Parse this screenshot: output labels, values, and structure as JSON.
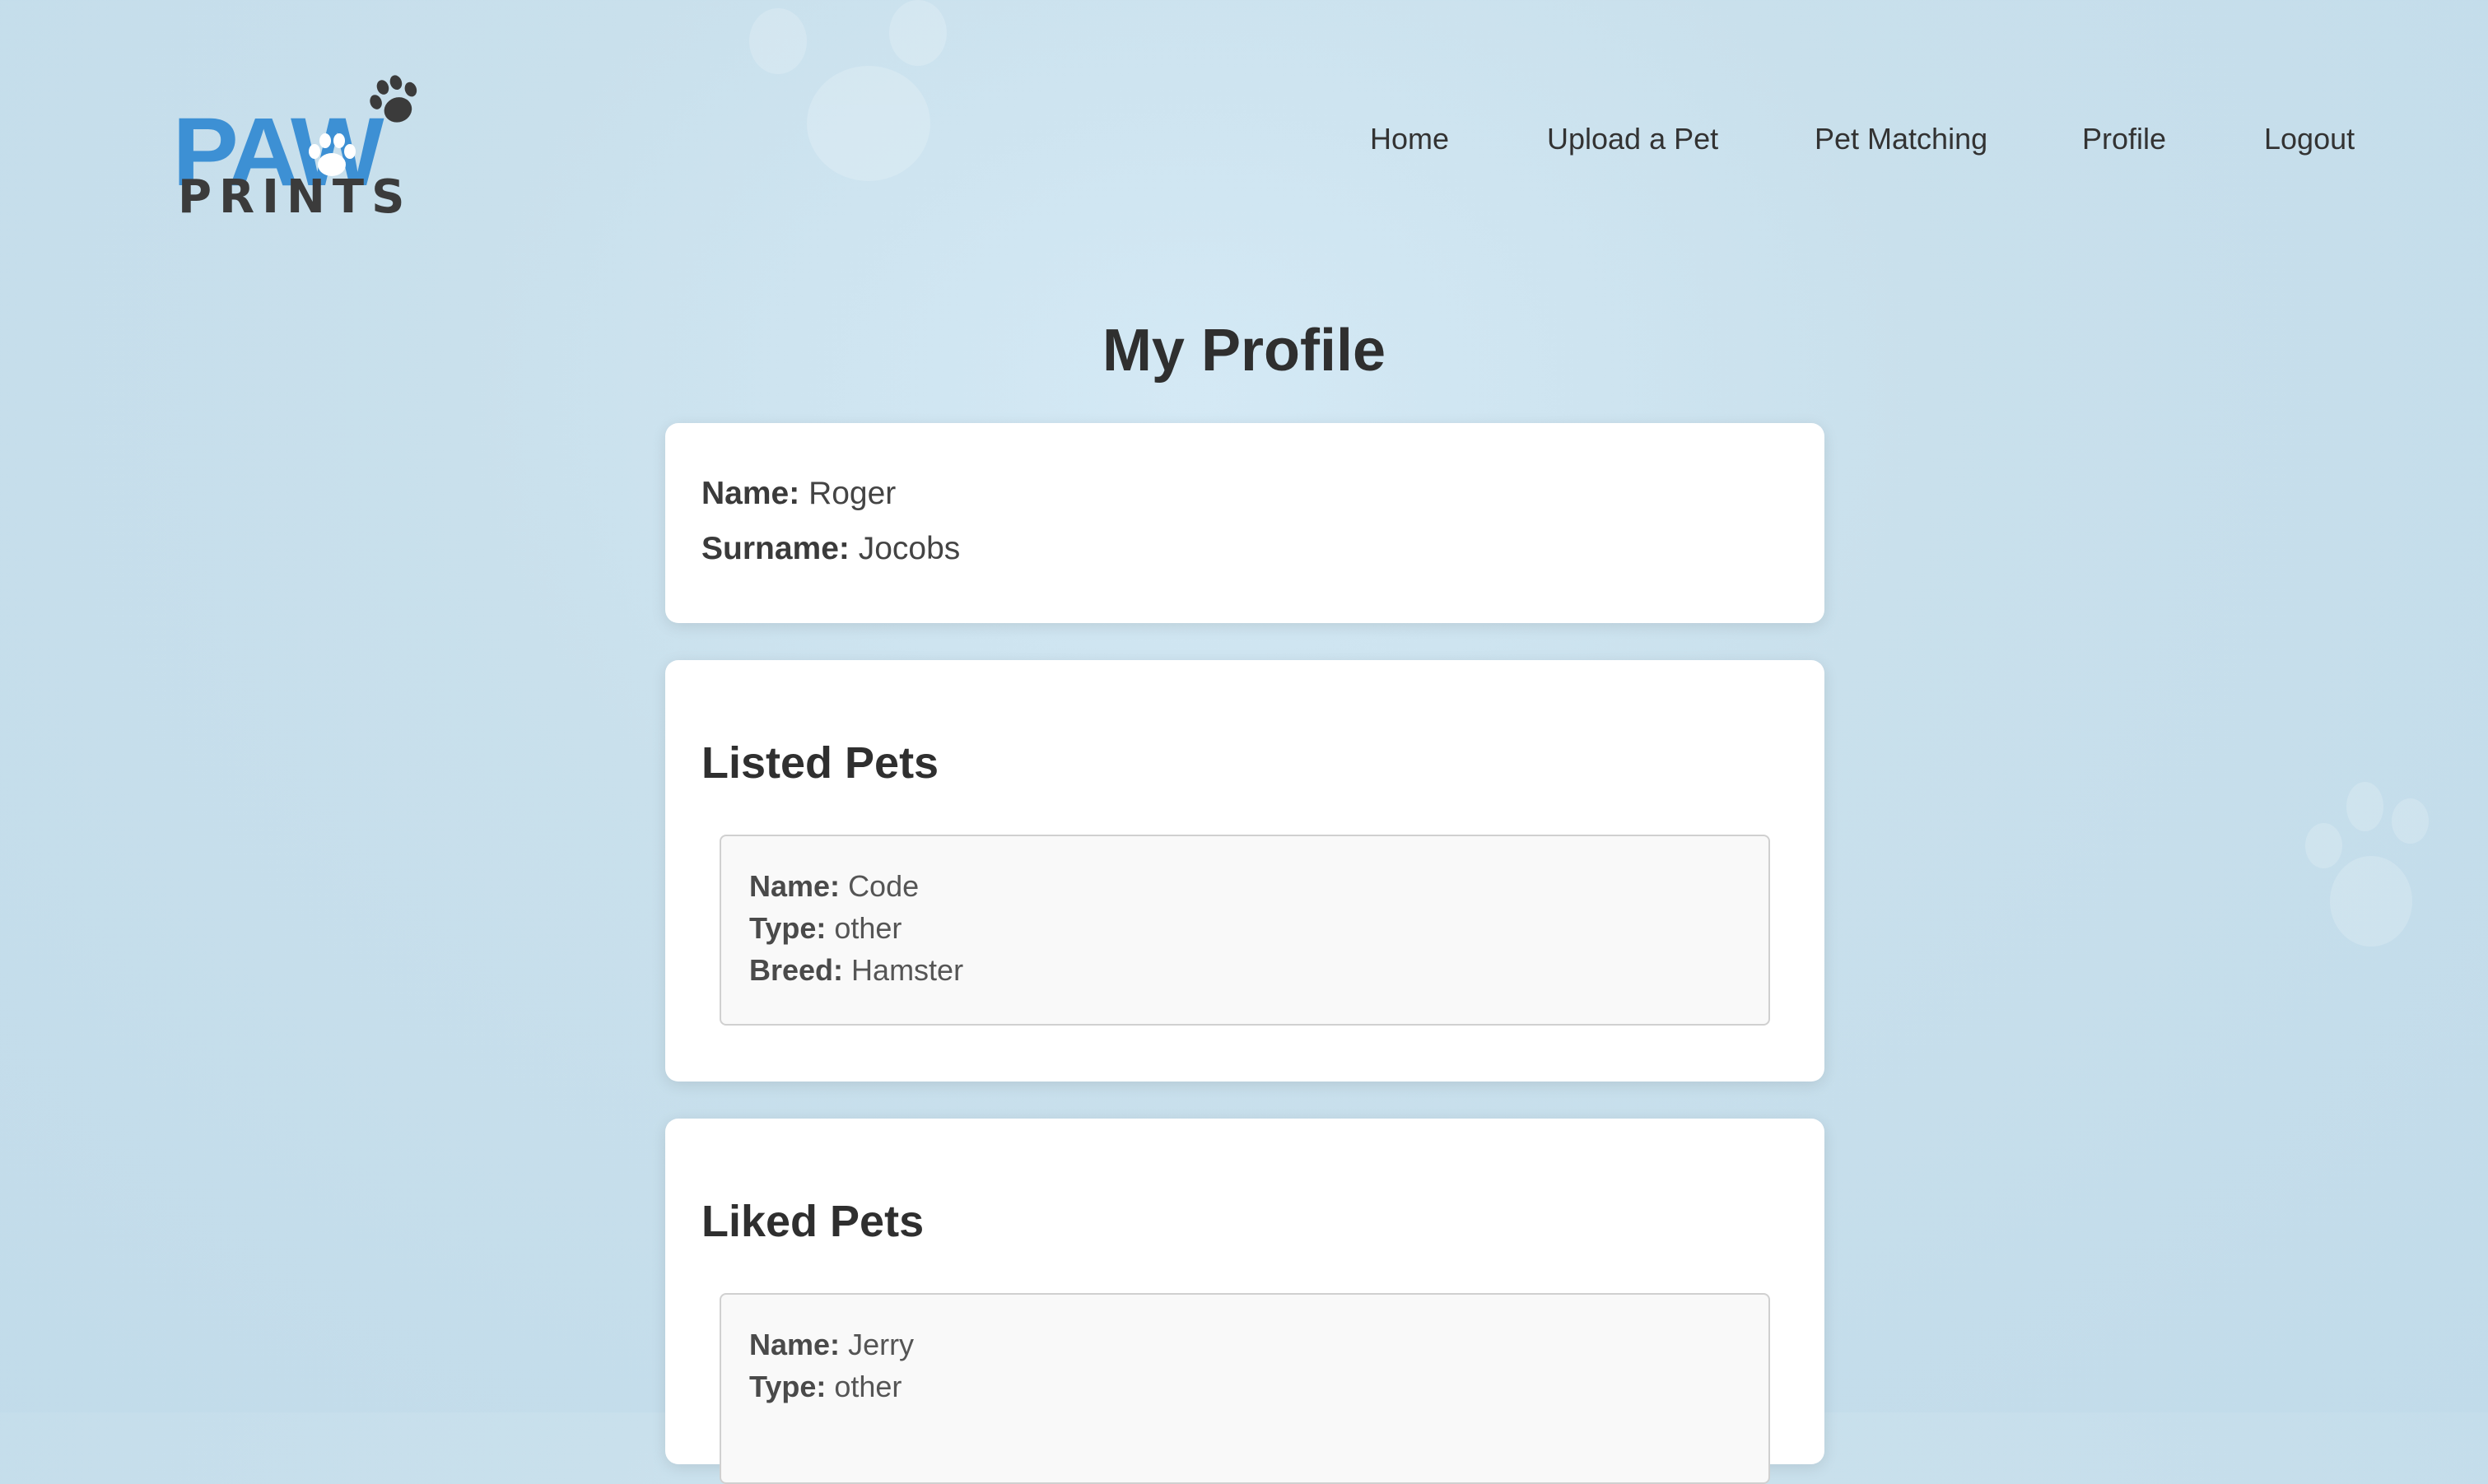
{
  "logo": {
    "word_top": "PAW",
    "word_bottom": "PRINTS",
    "colors": {
      "blue": "#3d90d4",
      "dark": "#3b3b3b"
    }
  },
  "nav": {
    "items": [
      {
        "label": "Home"
      },
      {
        "label": "Upload a Pet"
      },
      {
        "label": "Pet Matching"
      },
      {
        "label": "Profile"
      },
      {
        "label": "Logout"
      }
    ]
  },
  "page": {
    "title": "My Profile"
  },
  "profile": {
    "name_label": "Name:",
    "name_value": "Roger",
    "surname_label": "Surname:",
    "surname_value": "Jocobs"
  },
  "listed_pets": {
    "title": "Listed Pets",
    "items": [
      {
        "name_label": "Name:",
        "name": "Code",
        "type_label": "Type:",
        "type": "other",
        "breed_label": "Breed:",
        "breed": "Hamster"
      }
    ]
  },
  "liked_pets": {
    "title": "Liked Pets",
    "items": [
      {
        "name_label": "Name:",
        "name": "Jerry",
        "type_label": "Type:",
        "type": "other"
      }
    ]
  }
}
